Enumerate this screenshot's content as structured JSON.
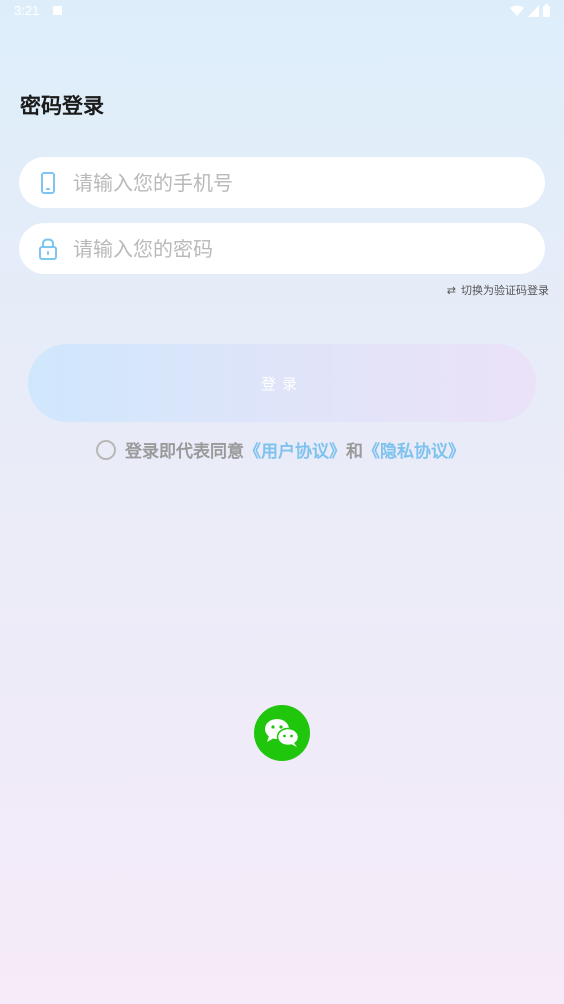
{
  "status_bar": {
    "time": "3:21"
  },
  "page": {
    "title": "密码登录"
  },
  "phone_input": {
    "placeholder": "请输入您的手机号",
    "value": ""
  },
  "password_input": {
    "placeholder": "请输入您的密码",
    "value": ""
  },
  "switch_mode": {
    "icon": "swap-arrows-icon",
    "label": "切换为验证码登录"
  },
  "login_button": {
    "label": "登录"
  },
  "agreement": {
    "checked": false,
    "prefix": "登录即代表同意",
    "user_agreement": "《用户协议》",
    "conjunction": "和",
    "privacy_policy": "《隐私协议》"
  },
  "social_login": {
    "icon": "wechat-icon"
  },
  "colors": {
    "accent_link": "#7ec2ee",
    "wechat_green": "#1fc60b",
    "icon_blue": "#7cc6ef"
  }
}
